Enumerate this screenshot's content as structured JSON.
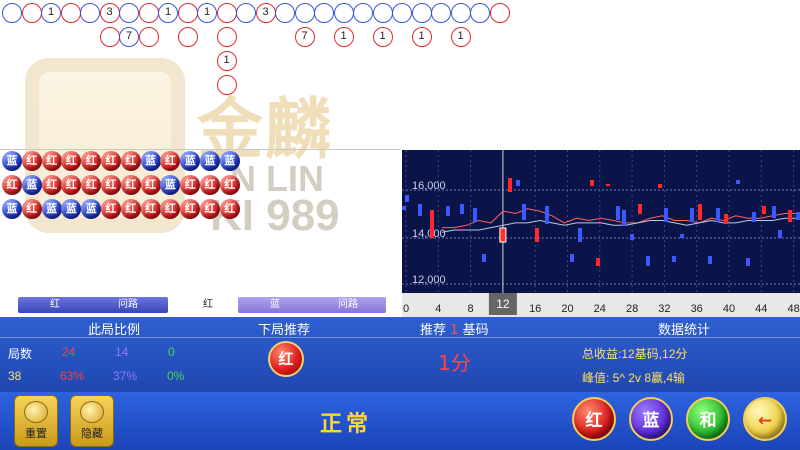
{
  "top_road": {
    "row1": [
      {
        "c": "b",
        "t": ""
      },
      {
        "c": "r",
        "t": ""
      },
      {
        "c": "b",
        "t": "1"
      },
      {
        "c": "r",
        "t": ""
      },
      {
        "c": "b",
        "t": ""
      },
      {
        "c": "r",
        "t": "3"
      },
      {
        "c": "b",
        "t": ""
      },
      {
        "c": "r",
        "t": ""
      },
      {
        "c": "b",
        "t": "1"
      },
      {
        "c": "r",
        "t": ""
      },
      {
        "c": "b",
        "t": "1"
      },
      {
        "c": "r",
        "t": ""
      },
      {
        "c": "b",
        "t": ""
      },
      {
        "c": "r",
        "t": "3"
      },
      {
        "c": "b",
        "t": ""
      },
      {
        "c": "b",
        "t": ""
      },
      {
        "c": "b",
        "t": ""
      },
      {
        "c": "b",
        "t": ""
      },
      {
        "c": "b",
        "t": ""
      },
      {
        "c": "b",
        "t": ""
      },
      {
        "c": "b",
        "t": ""
      },
      {
        "c": "b",
        "t": ""
      },
      {
        "c": "b",
        "t": ""
      },
      {
        "c": "b",
        "t": ""
      },
      {
        "c": "b",
        "t": ""
      },
      {
        "c": "r",
        "t": ""
      }
    ],
    "row2": [
      {
        "c": "r",
        "t": "",
        "col": 5
      },
      {
        "c": "b",
        "t": "7",
        "col": 6
      },
      {
        "c": "r",
        "t": "",
        "col": 7
      },
      {
        "c": "r",
        "t": "",
        "col": 9
      },
      {
        "c": "r",
        "t": "",
        "col": 11
      },
      {
        "c": "r",
        "t": "7",
        "col": 15
      },
      {
        "c": "r",
        "t": "1",
        "col": 17
      },
      {
        "c": "r",
        "t": "1",
        "col": 19
      },
      {
        "c": "r",
        "t": "1",
        "col": 21
      },
      {
        "c": "r",
        "t": "1",
        "col": 23
      }
    ],
    "row3": [
      {
        "c": "r",
        "t": "1",
        "col": 11
      }
    ],
    "row4": [
      {
        "c": "r",
        "t": "",
        "col": 11
      }
    ]
  },
  "watermark": {
    "cn": "金麟",
    "en1": "N LIN",
    "en2": "KI 989"
  },
  "bead_board": {
    "rows": [
      [
        "b",
        "r",
        "r",
        "r",
        "r",
        "r",
        "r",
        "b",
        "r",
        "b",
        "b",
        "b"
      ],
      [
        "r",
        "b",
        "r",
        "r",
        "r",
        "r",
        "r",
        "r",
        "b",
        "r",
        "r",
        "r"
      ],
      [
        "b",
        "r",
        "b",
        "b",
        "b",
        "r",
        "r",
        "r",
        "r",
        "r",
        "r",
        "r"
      ]
    ],
    "labels": {
      "r": "红",
      "b": "蓝"
    }
  },
  "road_tabs": {
    "red_label": "红",
    "red_road": "问路",
    "mid": "红",
    "blue_label": "蓝",
    "blue_road": "问路"
  },
  "chart_data": {
    "type": "line",
    "x_ticks": [
      0,
      4,
      8,
      12,
      16,
      20,
      24,
      28,
      32,
      36,
      40,
      44,
      48
    ],
    "y_ticks": [
      "16,000",
      "14,000",
      "12,000"
    ],
    "cursor_label": "12",
    "series": [
      {
        "name": "",
        "values": [
          14400,
          14400,
          14500,
          14700,
          14600,
          15100,
          15000,
          15200,
          15100,
          14900,
          14600,
          14800,
          14700,
          14800,
          14700,
          14600,
          14600,
          14800,
          14900,
          14700,
          14700,
          14600,
          14800,
          14700,
          14900,
          14800,
          14800,
          14900,
          15000,
          15000
        ]
      },
      {
        "name": "",
        "values": [
          14200,
          14300,
          14300,
          14300,
          14400,
          14500,
          14600,
          14600,
          14700,
          14600,
          14500,
          14600,
          14600,
          14600,
          14500,
          14500,
          14600,
          14700,
          14700,
          14600,
          14500,
          14600,
          14700,
          14600,
          14600,
          14700,
          14700,
          14700,
          14800,
          14800
        ]
      }
    ]
  },
  "stats": {
    "h1": "此局比例",
    "h2": "下局推荐",
    "h3_pre": "推荐",
    "h3_num": "1",
    "h3_post": "基码",
    "h4": "数据统计",
    "games_label": "局数",
    "games_red": "24",
    "games_blue": "14",
    "games_tie": "0",
    "total": "38",
    "pct_red": "63%",
    "pct_blue": "37%",
    "pct_tie": "0%",
    "rec": "红",
    "rec_points": "1分",
    "profit": "总收益:12基码,12分",
    "peak": "峰值:  5^  2v  8赢,4输"
  },
  "bottom": {
    "reset": "重置",
    "hide": "隐藏",
    "status": "正常",
    "red": "红",
    "blue": "蓝",
    "tie": "和",
    "back": "←"
  }
}
